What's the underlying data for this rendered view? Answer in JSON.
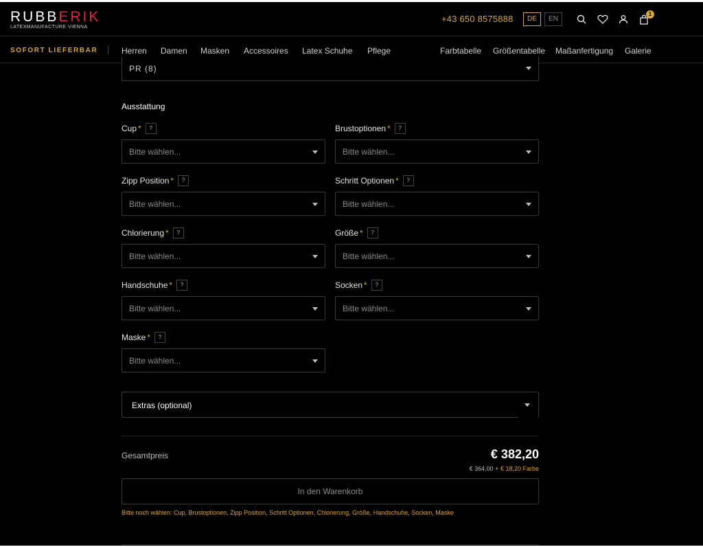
{
  "header": {
    "logo_part1": "RUBB",
    "logo_part2": "ERIK",
    "logo_sub": "LATEXMANUFACTURE·VIENNA",
    "phone": "+43 650 8575888",
    "lang_de": "DE",
    "lang_en": "EN",
    "cart_count": "1",
    "icons": [
      "search-icon",
      "heart-icon",
      "user-icon",
      "bag-icon"
    ]
  },
  "nav": {
    "promo": "SOFORT LIEFERBAR",
    "items": [
      "Herren",
      "Damen",
      "Masken",
      "Accessoires",
      "Latex Schuhe",
      "Pflege"
    ],
    "right_items": [
      "Farbtabelle",
      "Größentabelle",
      "Maßanfertigung",
      "Galerie"
    ]
  },
  "form": {
    "top_select_value": "PR (8)",
    "section_title": "Ausstattung",
    "placeholder": "Bitte wählen...",
    "required_mark": "*",
    "help_mark": "?",
    "fields": [
      {
        "label": "Cup"
      },
      {
        "label": "Brustoptionen"
      },
      {
        "label": "Zipp Position"
      },
      {
        "label": "Schritt Optionen"
      },
      {
        "label": "Chlorierung"
      },
      {
        "label": "Größe"
      },
      {
        "label": "Handschuhe"
      },
      {
        "label": "Socken"
      },
      {
        "label": "Maske"
      }
    ],
    "extras_label": "Extras (optional)"
  },
  "summary": {
    "total_label": "Gesamtpreis",
    "total_price": "€ 382,20",
    "base_price": "€ 364,00 +",
    "color_surcharge": "€ 18,20 Farbe",
    "add_to_cart": "In den Warenkorb",
    "hint": "Bitte noch wählen: Cup, Brustoptionen, Zipp Position, Schritt Optionen, Chlorierung, Größe, Handschuhe, Socken, Maske"
  },
  "colors": {
    "accent": "#d9a441",
    "logo_red": "#e2263c",
    "background": "#000000"
  }
}
